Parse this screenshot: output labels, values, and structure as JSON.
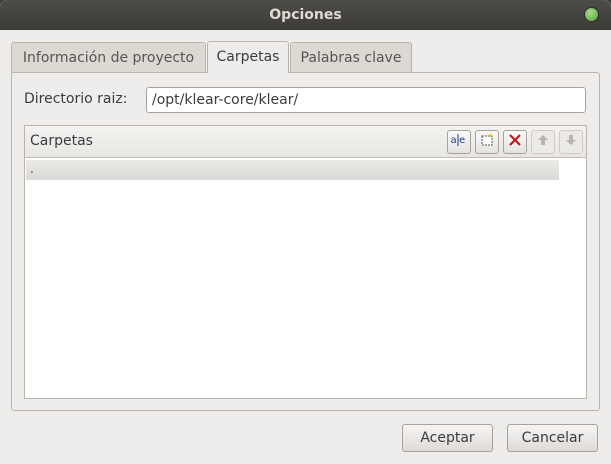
{
  "window": {
    "title": "Opciones"
  },
  "tabs": [
    {
      "label": "Información de proyecto"
    },
    {
      "label": "Carpetas"
    },
    {
      "label": "Palabras clave"
    }
  ],
  "active_tab": "Carpetas",
  "directory": {
    "label": "Directorio raiz:",
    "value": "/opt/klear-core/klear/"
  },
  "folders": {
    "title": "Carpetas",
    "toolbar": [
      {
        "icon": "rename-icon",
        "enabled": true
      },
      {
        "icon": "new-folder-icon",
        "enabled": true
      },
      {
        "icon": "delete-icon",
        "enabled": true
      },
      {
        "icon": "move-up-icon",
        "enabled": false
      },
      {
        "icon": "move-down-icon",
        "enabled": false
      }
    ],
    "items": [
      "."
    ]
  },
  "buttons": {
    "accept": "Aceptar",
    "cancel": "Cancelar"
  },
  "colors": {
    "titlebar": "#3c3b37",
    "dialog_bg": "#efedeb",
    "delete_icon": "#c4141a",
    "rename_icon": "#1a3f8f"
  }
}
